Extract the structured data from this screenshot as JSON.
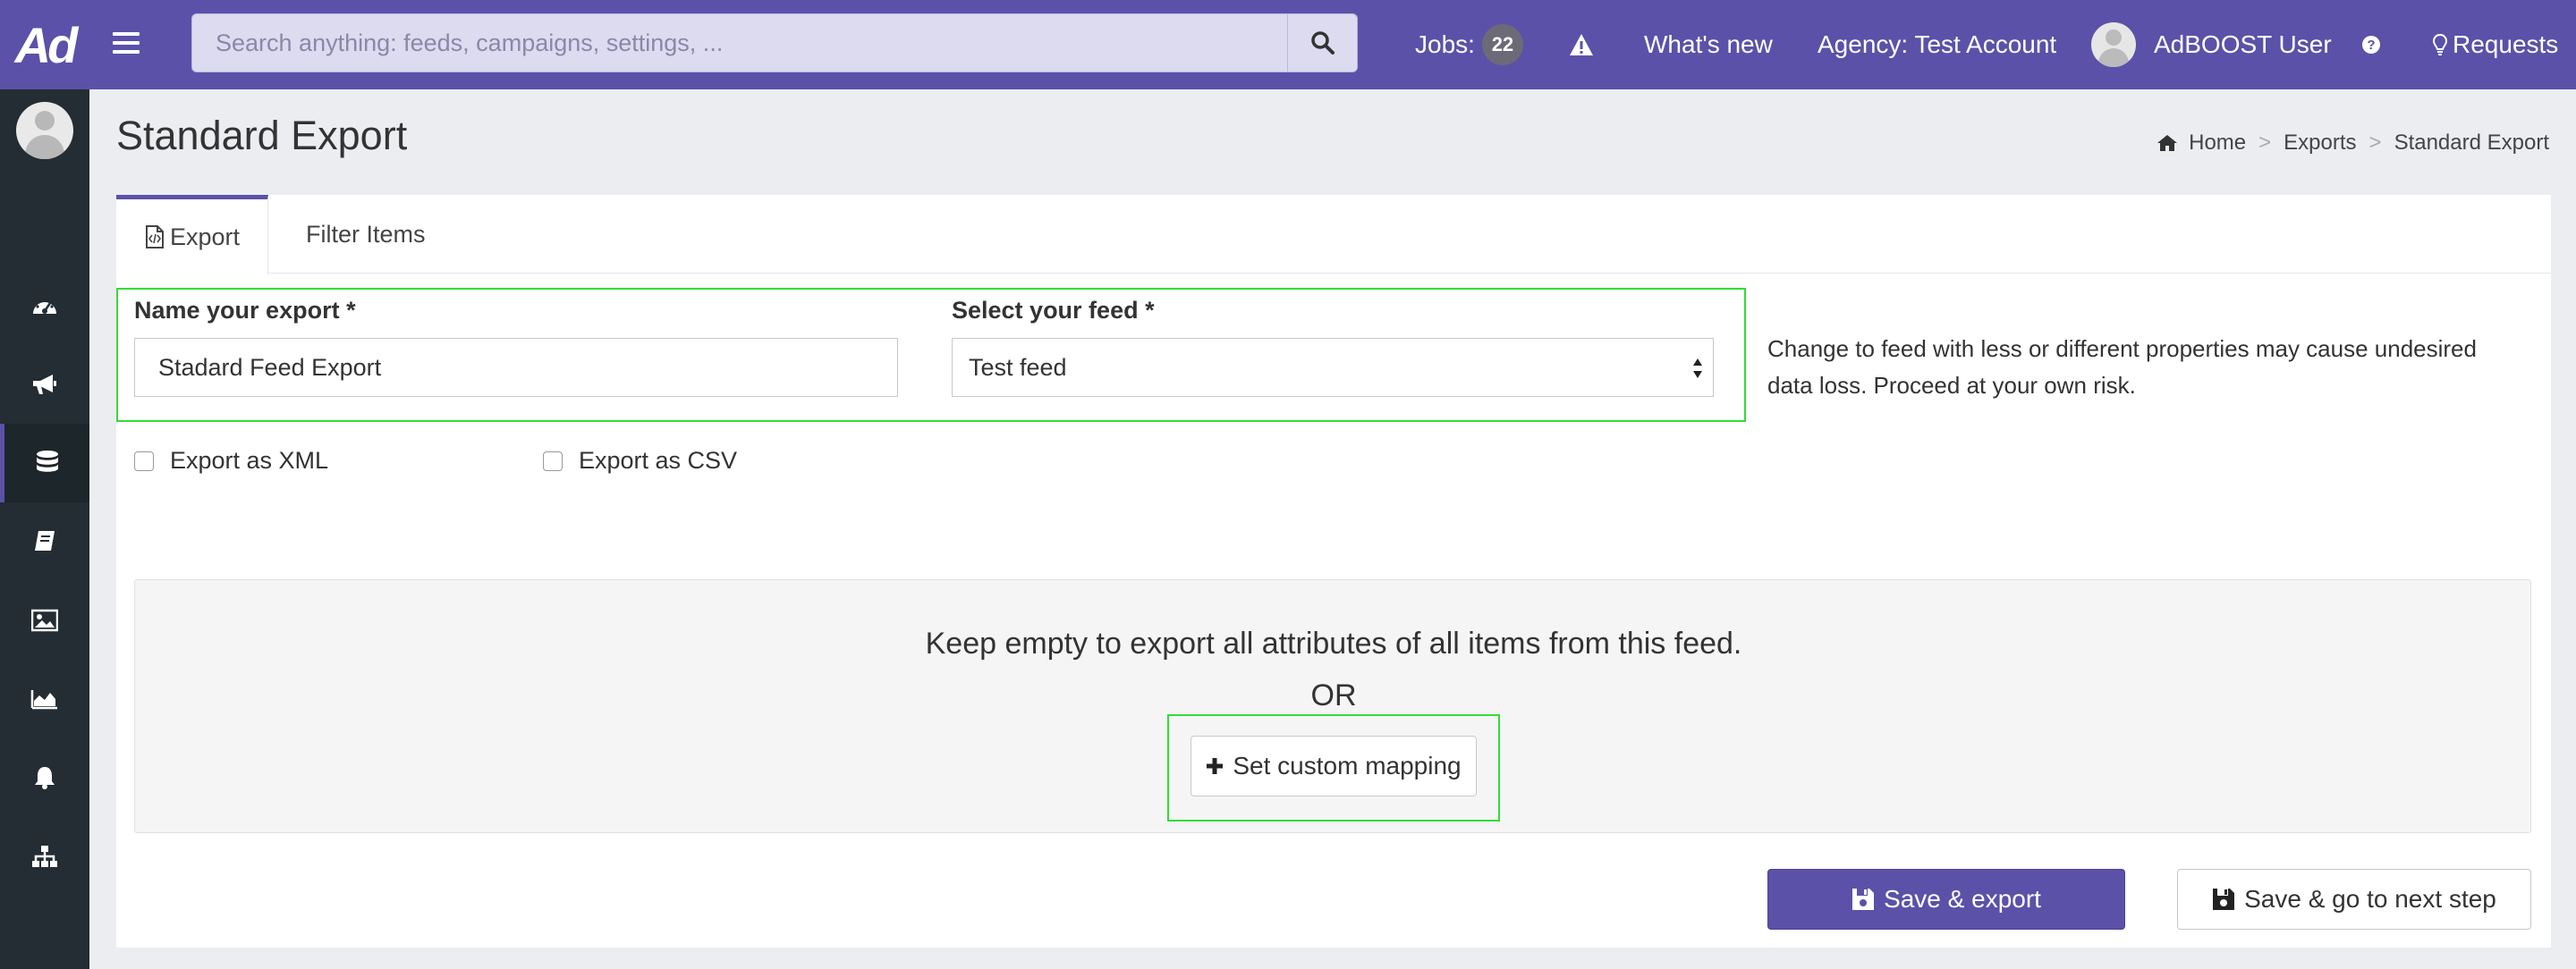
{
  "app": {
    "logo_text": "Ad"
  },
  "topbar": {
    "search_placeholder": "Search anything: feeds, campaigns, settings, ...",
    "jobs_label": "Jobs:",
    "jobs_count": "22",
    "whats_new": "What's new",
    "agency": "Agency: Test Account",
    "user_name": "AdBOOST User",
    "requests": "Requests"
  },
  "sidebar": {
    "items": [
      "dashboard-icon",
      "megaphone-icon",
      "database-icon",
      "book-icon",
      "image-icon",
      "area-chart-icon",
      "bell-icon",
      "sitemap-icon"
    ],
    "active_item": "database-icon"
  },
  "page": {
    "title": "Standard Export",
    "breadcrumb": [
      "Home",
      "Exports",
      "Standard Export"
    ]
  },
  "tabs": [
    "Export",
    "Filter Items"
  ],
  "form": {
    "name_label": "Name your export *",
    "name_value": "Stadard Feed Export",
    "feed_label": "Select your feed *",
    "feed_value": "Test feed",
    "warning": "Change to feed with less or different properties may cause undesired data loss. Proceed at your own risk.",
    "export_xml": "Export as XML",
    "export_csv": "Export as CSV"
  },
  "mapping": {
    "hint": "Keep empty to export all attributes of all items from this feed.",
    "or": "OR",
    "custom_mapping_button": "Set custom mapping"
  },
  "actions": {
    "save_export": "Save & export",
    "save_next": "Save & go to next step"
  },
  "colors": {
    "primary": "#5b51a8",
    "sidebar": "#232d33",
    "highlight": "#33dd33"
  }
}
